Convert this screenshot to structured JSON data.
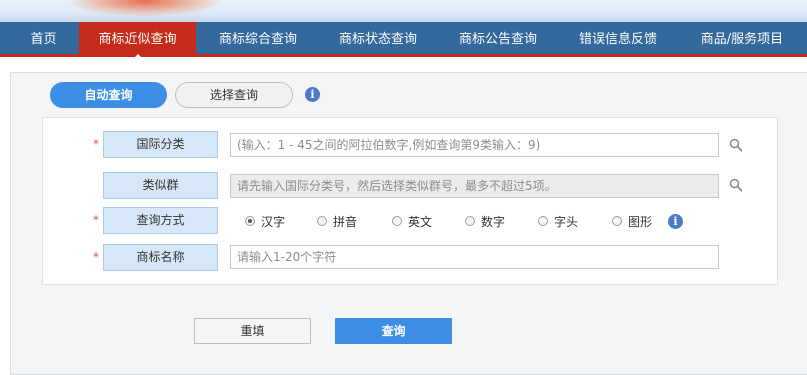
{
  "nav": {
    "items": [
      {
        "label": "首页"
      },
      {
        "label": "商标近似查询"
      },
      {
        "label": "商标综合查询"
      },
      {
        "label": "商标状态查询"
      },
      {
        "label": "商标公告查询"
      },
      {
        "label": "错误信息反馈"
      },
      {
        "label": "商品/服务项目"
      }
    ],
    "active_index": 1
  },
  "tabs": {
    "auto": "自动查询",
    "select": "选择查询",
    "info_icon": "info-icon"
  },
  "form": {
    "required_mark": "*",
    "intl_class": {
      "label": "国际分类",
      "placeholder": "(输入：1 - 45之间的阿拉伯数字,例如查询第9类输入：9)",
      "value": ""
    },
    "similar_group": {
      "label": "类似群",
      "placeholder": "请先输入国际分类号，然后选择类似群号，最多不超过5项。",
      "value": ""
    },
    "query_mode": {
      "label": "查询方式",
      "options": [
        "汉字",
        "拼音",
        "英文",
        "数字",
        "字头",
        "图形"
      ],
      "selected": "汉字"
    },
    "tm_name": {
      "label": "商标名称",
      "placeholder": "请输入1-20个字符",
      "value": ""
    }
  },
  "buttons": {
    "reset": "重填",
    "query": "查询"
  },
  "colors": {
    "nav_bg": "#33699c",
    "nav_active": "#c62a1a",
    "accent_blue": "#3d8ee6",
    "label_bg": "#d6e8f8",
    "required": "#d9534f"
  }
}
